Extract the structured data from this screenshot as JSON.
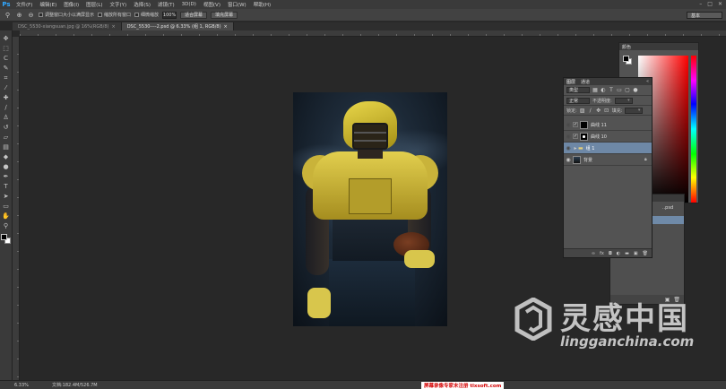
{
  "app": {
    "logo": "Ps"
  },
  "menu": [
    {
      "label": "文件(F)"
    },
    {
      "label": "编辑(E)"
    },
    {
      "label": "图像(I)"
    },
    {
      "label": "图层(L)"
    },
    {
      "label": "文字(Y)"
    },
    {
      "label": "选择(S)"
    },
    {
      "label": "滤镜(T)"
    },
    {
      "label": "3D(D)"
    },
    {
      "label": "视图(V)"
    },
    {
      "label": "窗口(W)"
    },
    {
      "label": "帮助(H)"
    }
  ],
  "window_controls": {
    "minimize": "–",
    "maximize": "□",
    "close": "✕"
  },
  "options_bar": {
    "resize_windows": "调整窗口大小以满屏显示",
    "zoom_all": "缩放所有窗口",
    "scrubby_zoom": "细微缩放",
    "zoom_value": "100%",
    "fit_screen": "适合屏幕",
    "fill_screen": "填充屏幕",
    "workspace": "基本"
  },
  "tabs": [
    {
      "label": "DSC_5530-xiangsuan.jpg @ 16%(RGB/8)",
      "close": "×"
    },
    {
      "label": "DSC_5530----2.psd @ 6.33% (组 1, RGB/8)",
      "close": "×"
    }
  ],
  "tools": [
    {
      "icon": "move-icon",
      "glyph": "✥"
    },
    {
      "icon": "marquee-icon",
      "glyph": "⬚"
    },
    {
      "icon": "lasso-icon",
      "glyph": "ᑕ"
    },
    {
      "icon": "quick-select-icon",
      "glyph": "✎"
    },
    {
      "icon": "crop-icon",
      "glyph": "⌗"
    },
    {
      "icon": "eyedropper-icon",
      "glyph": "⁄"
    },
    {
      "icon": "healing-icon",
      "glyph": "✚"
    },
    {
      "icon": "brush-icon",
      "glyph": "∕"
    },
    {
      "icon": "stamp-icon",
      "glyph": "♙"
    },
    {
      "icon": "history-brush-icon",
      "glyph": "↺"
    },
    {
      "icon": "eraser-icon",
      "glyph": "▱"
    },
    {
      "icon": "gradient-icon",
      "glyph": "▤"
    },
    {
      "icon": "blur-icon",
      "glyph": "◆"
    },
    {
      "icon": "dodge-icon",
      "glyph": "●"
    },
    {
      "icon": "pen-icon",
      "glyph": "✒"
    },
    {
      "icon": "type-icon",
      "glyph": "T"
    },
    {
      "icon": "path-select-icon",
      "glyph": "➤"
    },
    {
      "icon": "shape-icon",
      "glyph": "▭"
    },
    {
      "icon": "hand-icon",
      "glyph": "✋"
    },
    {
      "icon": "zoom-icon",
      "glyph": "⚲"
    }
  ],
  "color_panel": {
    "tab_label": "颜色"
  },
  "layers_panel": {
    "tab_layers": "图层",
    "tab_channels": "通道",
    "filter_kind": "类型",
    "blend_mode": "正常",
    "opacity_label": "不透明度:",
    "lock_label": "锁定:",
    "fill_label": "填充:",
    "layers": [
      {
        "name": "曲线 11",
        "visible": false,
        "type": "adjustment-black"
      },
      {
        "name": "曲线 10",
        "visible": false,
        "type": "adjustment-mask"
      },
      {
        "name": "组 1",
        "visible": false,
        "type": "group",
        "selected": true
      },
      {
        "name": "背景",
        "visible": true,
        "type": "photo",
        "locked": true
      }
    ],
    "footer_icons": [
      "link",
      "fx",
      "mask",
      "adjust",
      "folder",
      "new",
      "trash"
    ]
  },
  "back_panel": {
    "item_text": "..psd"
  },
  "watermark": {
    "cn": "灵感中国",
    "url": "lingganchina.com"
  },
  "status": {
    "zoom": "6.33%",
    "doc": "文档:182.4M/526.7M",
    "notice": "屏幕录像专家未注册 tlxsoft.com"
  },
  "colors": {
    "accent": "#31a8ff",
    "selected_layer": "#6e88a6",
    "background": "#282828"
  }
}
